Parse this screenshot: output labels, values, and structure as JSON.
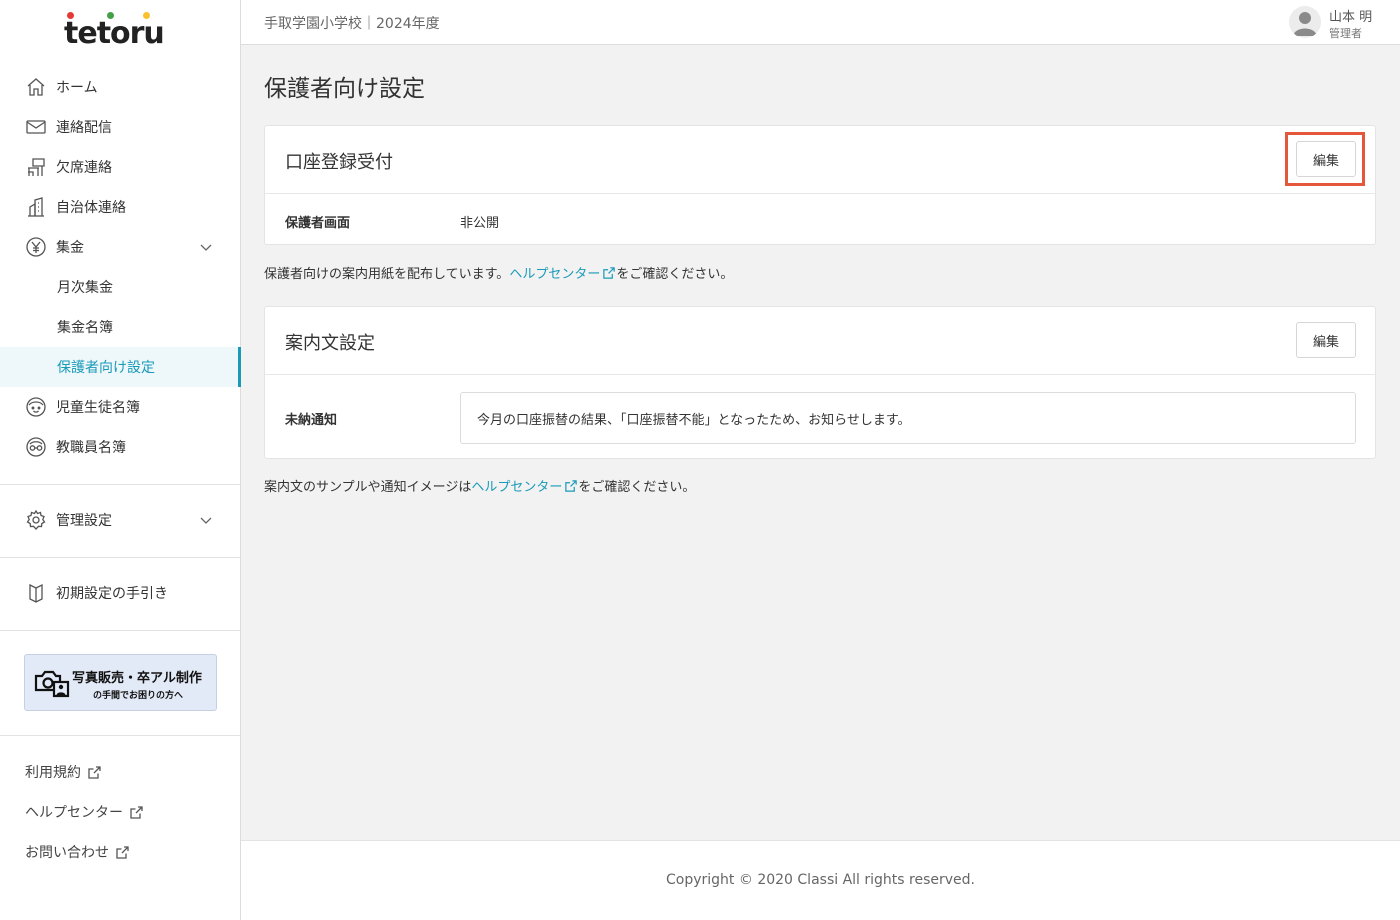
{
  "brand": {
    "logo_text": "tetoru",
    "dot_colors": [
      "#e53935",
      "#43a047",
      "#fbc02d"
    ]
  },
  "sidebar": {
    "items": [
      {
        "label": "ホーム",
        "icon": "home-icon"
      },
      {
        "label": "連絡配信",
        "icon": "mail-icon"
      },
      {
        "label": "欠席連絡",
        "icon": "desk-icon"
      },
      {
        "label": "自治体連絡",
        "icon": "building-icon"
      },
      {
        "label": "集金",
        "icon": "yen-icon"
      },
      {
        "label": "月次集金"
      },
      {
        "label": "集金名簿"
      },
      {
        "label": "保護者向け設定"
      },
      {
        "label": "児童生徒名簿",
        "icon": "student-icon"
      },
      {
        "label": "教職員名簿",
        "icon": "teacher-icon"
      }
    ],
    "admin": {
      "label": "管理設定",
      "icon": "gear-icon"
    },
    "guide": {
      "label": "初期設定の手引き",
      "icon": "book-icon"
    },
    "banner": {
      "title": "写真販売・卒アル制作",
      "subtitle": "の手間でお困りの方へ"
    },
    "footer_links": [
      {
        "label": "利用規約"
      },
      {
        "label": "ヘルプセンター"
      },
      {
        "label": "お問い合わせ"
      }
    ],
    "accent_color": "#1a9ab8"
  },
  "header": {
    "school": "手取学園小学校｜2024年度",
    "user_name": "山本 明",
    "user_role": "管理者"
  },
  "main": {
    "title": "保護者向け設定",
    "account_card": {
      "title": "口座登録受付",
      "edit_label": "編集",
      "row_label": "保護者画面",
      "row_value": "非公開"
    },
    "note1": {
      "prefix": "保護者向けの案内用紙を配布しています。",
      "link": "ヘルプセンター",
      "suffix": "をご確認ください。"
    },
    "guide_card": {
      "title": "案内文設定",
      "edit_label": "編集",
      "row_label": "未納通知",
      "row_value": "今月の口座振替の結果、「口座振替不能」となったため、お知らせします。"
    },
    "note2": {
      "prefix": "案内文のサンプルや通知イメージは",
      "link": "ヘルプセンター",
      "suffix": "をご確認ください。"
    },
    "highlight_color": "#e4573a"
  },
  "footer": {
    "copyright": "Copyright © 2020 Classi All rights reserved."
  }
}
